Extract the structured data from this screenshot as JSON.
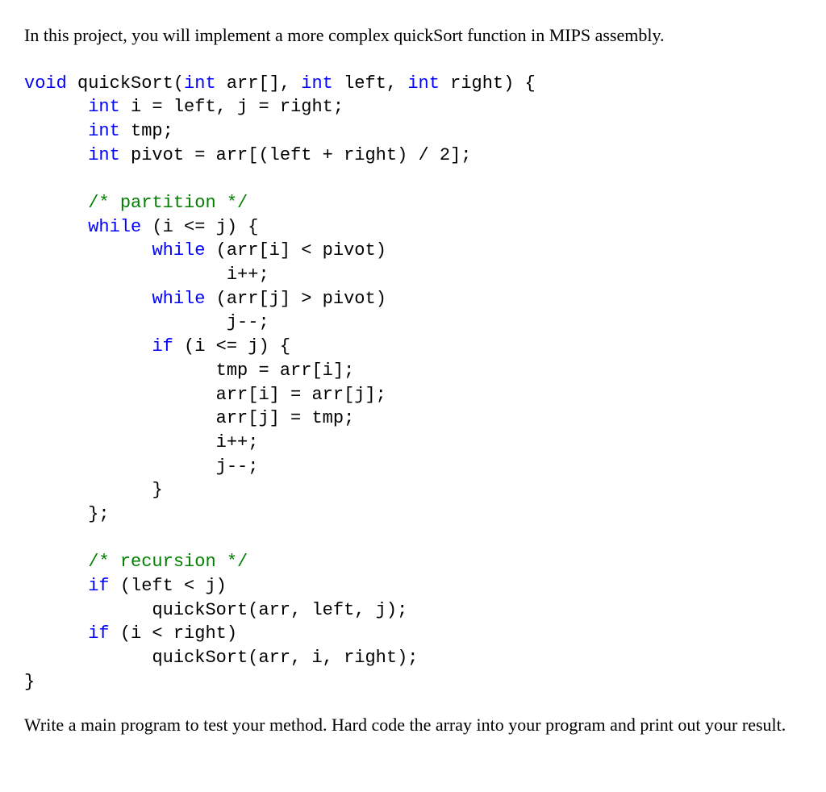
{
  "intro": "In this project, you will implement a more complex quickSort function in MIPS assembly.",
  "outro": "Write a main program to test your method.  Hard code the array into your program and print out your result.",
  "code": {
    "l01": {
      "kw_void": "void",
      "t1": " quickSort(",
      "kw_int1": "int",
      "t2": " arr[], ",
      "kw_int2": "int",
      "t3": " left, ",
      "kw_int3": "int",
      "t4": " right) {"
    },
    "l02": {
      "pad": "      ",
      "kw_int": "int",
      "t": " i = left, j = right;"
    },
    "l03": {
      "pad": "      ",
      "kw_int": "int",
      "t": " tmp;"
    },
    "l04": {
      "pad": "      ",
      "kw_int": "int",
      "t": " pivot = arr[(left + right) / 2];"
    },
    "l06": {
      "pad": "      ",
      "cm": "/* partition */"
    },
    "l07": {
      "pad": "      ",
      "kw_while": "while",
      "t": " (i <= j) {"
    },
    "l08": {
      "pad": "            ",
      "kw_while": "while",
      "t": " (arr[i] < pivot)"
    },
    "l09": {
      "pad": "                   ",
      "t": "i++;"
    },
    "l10": {
      "pad": "            ",
      "kw_while": "while",
      "t": " (arr[j] > pivot)"
    },
    "l11": {
      "pad": "                   ",
      "t": "j--;"
    },
    "l12": {
      "pad": "            ",
      "kw_if": "if",
      "t": " (i <= j) {"
    },
    "l13": {
      "pad": "                  ",
      "t": "tmp = arr[i];"
    },
    "l14": {
      "pad": "                  ",
      "t": "arr[i] = arr[j];"
    },
    "l15": {
      "pad": "                  ",
      "t": "arr[j] = tmp;"
    },
    "l16": {
      "pad": "                  ",
      "t": "i++;"
    },
    "l17": {
      "pad": "                  ",
      "t": "j--;"
    },
    "l18": {
      "pad": "            ",
      "t": "}"
    },
    "l19": {
      "pad": "      ",
      "t": "};"
    },
    "l21": {
      "pad": "      ",
      "cm": "/* recursion */"
    },
    "l22": {
      "pad": "      ",
      "kw_if": "if",
      "t": " (left < j)"
    },
    "l23": {
      "pad": "            ",
      "t": "quickSort(arr, left, j);"
    },
    "l24": {
      "pad": "      ",
      "kw_if": "if",
      "t": " (i < right)"
    },
    "l25": {
      "pad": "            ",
      "t": "quickSort(arr, i, right);"
    },
    "l26": {
      "t": "}"
    }
  }
}
